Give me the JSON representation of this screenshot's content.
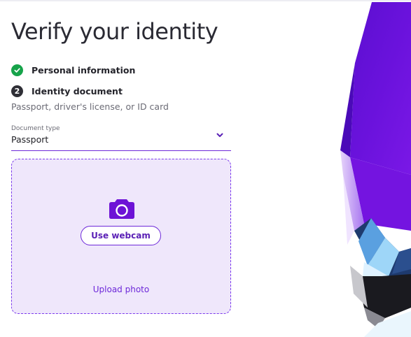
{
  "page": {
    "title": "Verify your identity"
  },
  "steps": [
    {
      "label": "Personal information",
      "status": "complete",
      "icon": "check-icon"
    },
    {
      "label": "Identity document",
      "status": "current",
      "number": "2"
    }
  ],
  "document_step": {
    "subtitle": "Passport, driver's license, or ID card"
  },
  "document_type": {
    "label": "Document type",
    "value": "Passport",
    "icon": "chevron-down-icon"
  },
  "upload": {
    "camera_icon": "camera-icon",
    "webcam_label": "Use webcam",
    "upload_label": "Upload photo"
  },
  "colors": {
    "accent": "#6d28d9",
    "complete": "#16a34a",
    "dropzone_bg": "#efe7fb",
    "art_purple": "#6a10d6"
  }
}
